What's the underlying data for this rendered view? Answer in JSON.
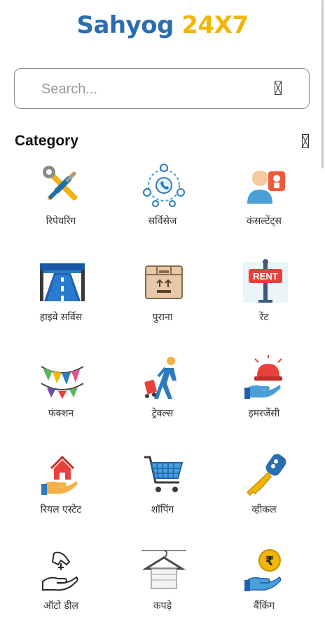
{
  "app": {
    "title_part1": "Sahyog",
    "title_part2": "24X7",
    "brand_colors": {
      "primary": "#2a6db0",
      "accent": "#f2b705"
    }
  },
  "search": {
    "placeholder": "Search...",
    "value": ""
  },
  "category": {
    "title": "Category",
    "items": [
      {
        "label": "रिपेयरिंग",
        "icon": "tools-icon"
      },
      {
        "label": "सर्विसेज",
        "icon": "services-network-icon"
      },
      {
        "label": "कंसल्टेंट्स",
        "icon": "consultant-icon"
      },
      {
        "label": "हाइवे सर्विस",
        "icon": "highway-icon"
      },
      {
        "label": "पुराना",
        "icon": "box-icon"
      },
      {
        "label": "रेंट",
        "icon": "rent-sign-icon"
      },
      {
        "label": "फंक्शन",
        "icon": "bunting-icon"
      },
      {
        "label": "ट्रेवल्स",
        "icon": "traveler-icon"
      },
      {
        "label": "इमरजेंसी",
        "icon": "emergency-siren-icon"
      },
      {
        "label": "रियल एस्टेट",
        "icon": "house-hand-icon"
      },
      {
        "label": "शॉपिंग",
        "icon": "shopping-cart-icon"
      },
      {
        "label": "व्हीकल",
        "icon": "car-key-icon"
      },
      {
        "label": "ऑटो डील",
        "icon": "auto-deal-icon"
      },
      {
        "label": "कपड़े",
        "icon": "clothes-hanger-icon"
      },
      {
        "label": "बैंकिंग",
        "icon": "banking-icon"
      }
    ]
  }
}
